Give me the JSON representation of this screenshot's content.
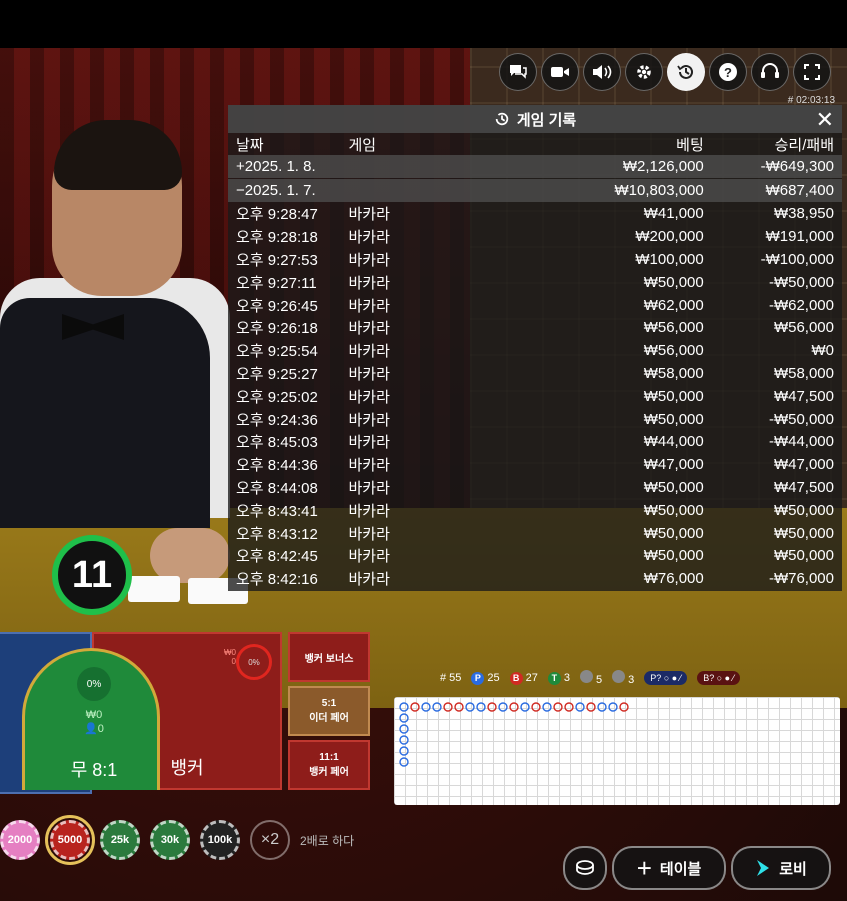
{
  "toolbar": {
    "icons": [
      "chat-icon",
      "video-icon",
      "volume-icon",
      "gear-icon",
      "history-icon",
      "help-icon",
      "headset-icon",
      "fullscreen-icon"
    ],
    "round_id": "# 02:03:13"
  },
  "history": {
    "title": "게임 기록",
    "columns": [
      "날짜",
      "게임",
      "베팅",
      "승리/패배"
    ],
    "summaries": [
      {
        "date": "+2025. 1. 8.",
        "bet": "₩2,126,000",
        "result": "-₩649,300"
      },
      {
        "date": "−2025. 1. 7.",
        "bet": "₩10,803,000",
        "result": "₩687,400"
      }
    ],
    "rows": [
      {
        "time": "오후 9:28:47",
        "game": "바카라",
        "bet": "₩41,000",
        "result": "₩38,950"
      },
      {
        "time": "오후 9:28:18",
        "game": "바카라",
        "bet": "₩200,000",
        "result": "₩191,000"
      },
      {
        "time": "오후 9:27:53",
        "game": "바카라",
        "bet": "₩100,000",
        "result": "-₩100,000"
      },
      {
        "time": "오후 9:27:11",
        "game": "바카라",
        "bet": "₩50,000",
        "result": "-₩50,000"
      },
      {
        "time": "오후 9:26:45",
        "game": "바카라",
        "bet": "₩62,000",
        "result": "-₩62,000"
      },
      {
        "time": "오후 9:26:18",
        "game": "바카라",
        "bet": "₩56,000",
        "result": "₩56,000"
      },
      {
        "time": "오후 9:25:54",
        "game": "바카라",
        "bet": "₩56,000",
        "result": "₩0"
      },
      {
        "time": "오후 9:25:27",
        "game": "바카라",
        "bet": "₩58,000",
        "result": "₩58,000"
      },
      {
        "time": "오후 9:25:02",
        "game": "바카라",
        "bet": "₩50,000",
        "result": "₩47,500"
      },
      {
        "time": "오후 9:24:36",
        "game": "바카라",
        "bet": "₩50,000",
        "result": "-₩50,000"
      },
      {
        "time": "오후 8:45:03",
        "game": "바카라",
        "bet": "₩44,000",
        "result": "-₩44,000"
      },
      {
        "time": "오후 8:44:36",
        "game": "바카라",
        "bet": "₩47,000",
        "result": "₩47,000"
      },
      {
        "time": "오후 8:44:08",
        "game": "바카라",
        "bet": "₩50,000",
        "result": "₩47,500"
      },
      {
        "time": "오후 8:43:41",
        "game": "바카라",
        "bet": "₩50,000",
        "result": "₩50,000"
      },
      {
        "time": "오후 8:43:12",
        "game": "바카라",
        "bet": "₩50,000",
        "result": "₩50,000"
      },
      {
        "time": "오후 8:42:45",
        "game": "바카라",
        "bet": "₩50,000",
        "result": "₩50,000"
      },
      {
        "time": "오후 8:42:16",
        "game": "바카라",
        "bet": "₩76,000",
        "result": "-₩76,000"
      }
    ]
  },
  "timer": "11",
  "bets": {
    "tie_pct": "0%",
    "tie_amount": "₩0",
    "tie_players": "0",
    "tie_label": "무 8:1",
    "banker_label": "뱅커",
    "banker_bonus": "뱅커 보너스",
    "either_pair_odds": "5:1",
    "either_pair": "이더 페어",
    "banker_pair_odds": "11:1",
    "banker_pair": "뱅커 페어"
  },
  "stats": {
    "round": "# 55",
    "player": "25",
    "player_letter": "P",
    "banker": "27",
    "banker_letter": "B",
    "tie": "3",
    "tie_letter": "T",
    "player_pairs": "5",
    "banker_pairs": "3",
    "player_predict": "P?",
    "banker_predict": "B?"
  },
  "chips": [
    "2000",
    "5000",
    "25k",
    "30k",
    "100k"
  ],
  "double": "×2",
  "double_label": "2배로 하다",
  "buttons": {
    "table": "테이블",
    "lobby": "로비"
  },
  "colors": {
    "player": "#1d3f7a",
    "banker": "#8e1d1a",
    "tie": "#1f8a3a",
    "timer": "#1fbf4a"
  }
}
